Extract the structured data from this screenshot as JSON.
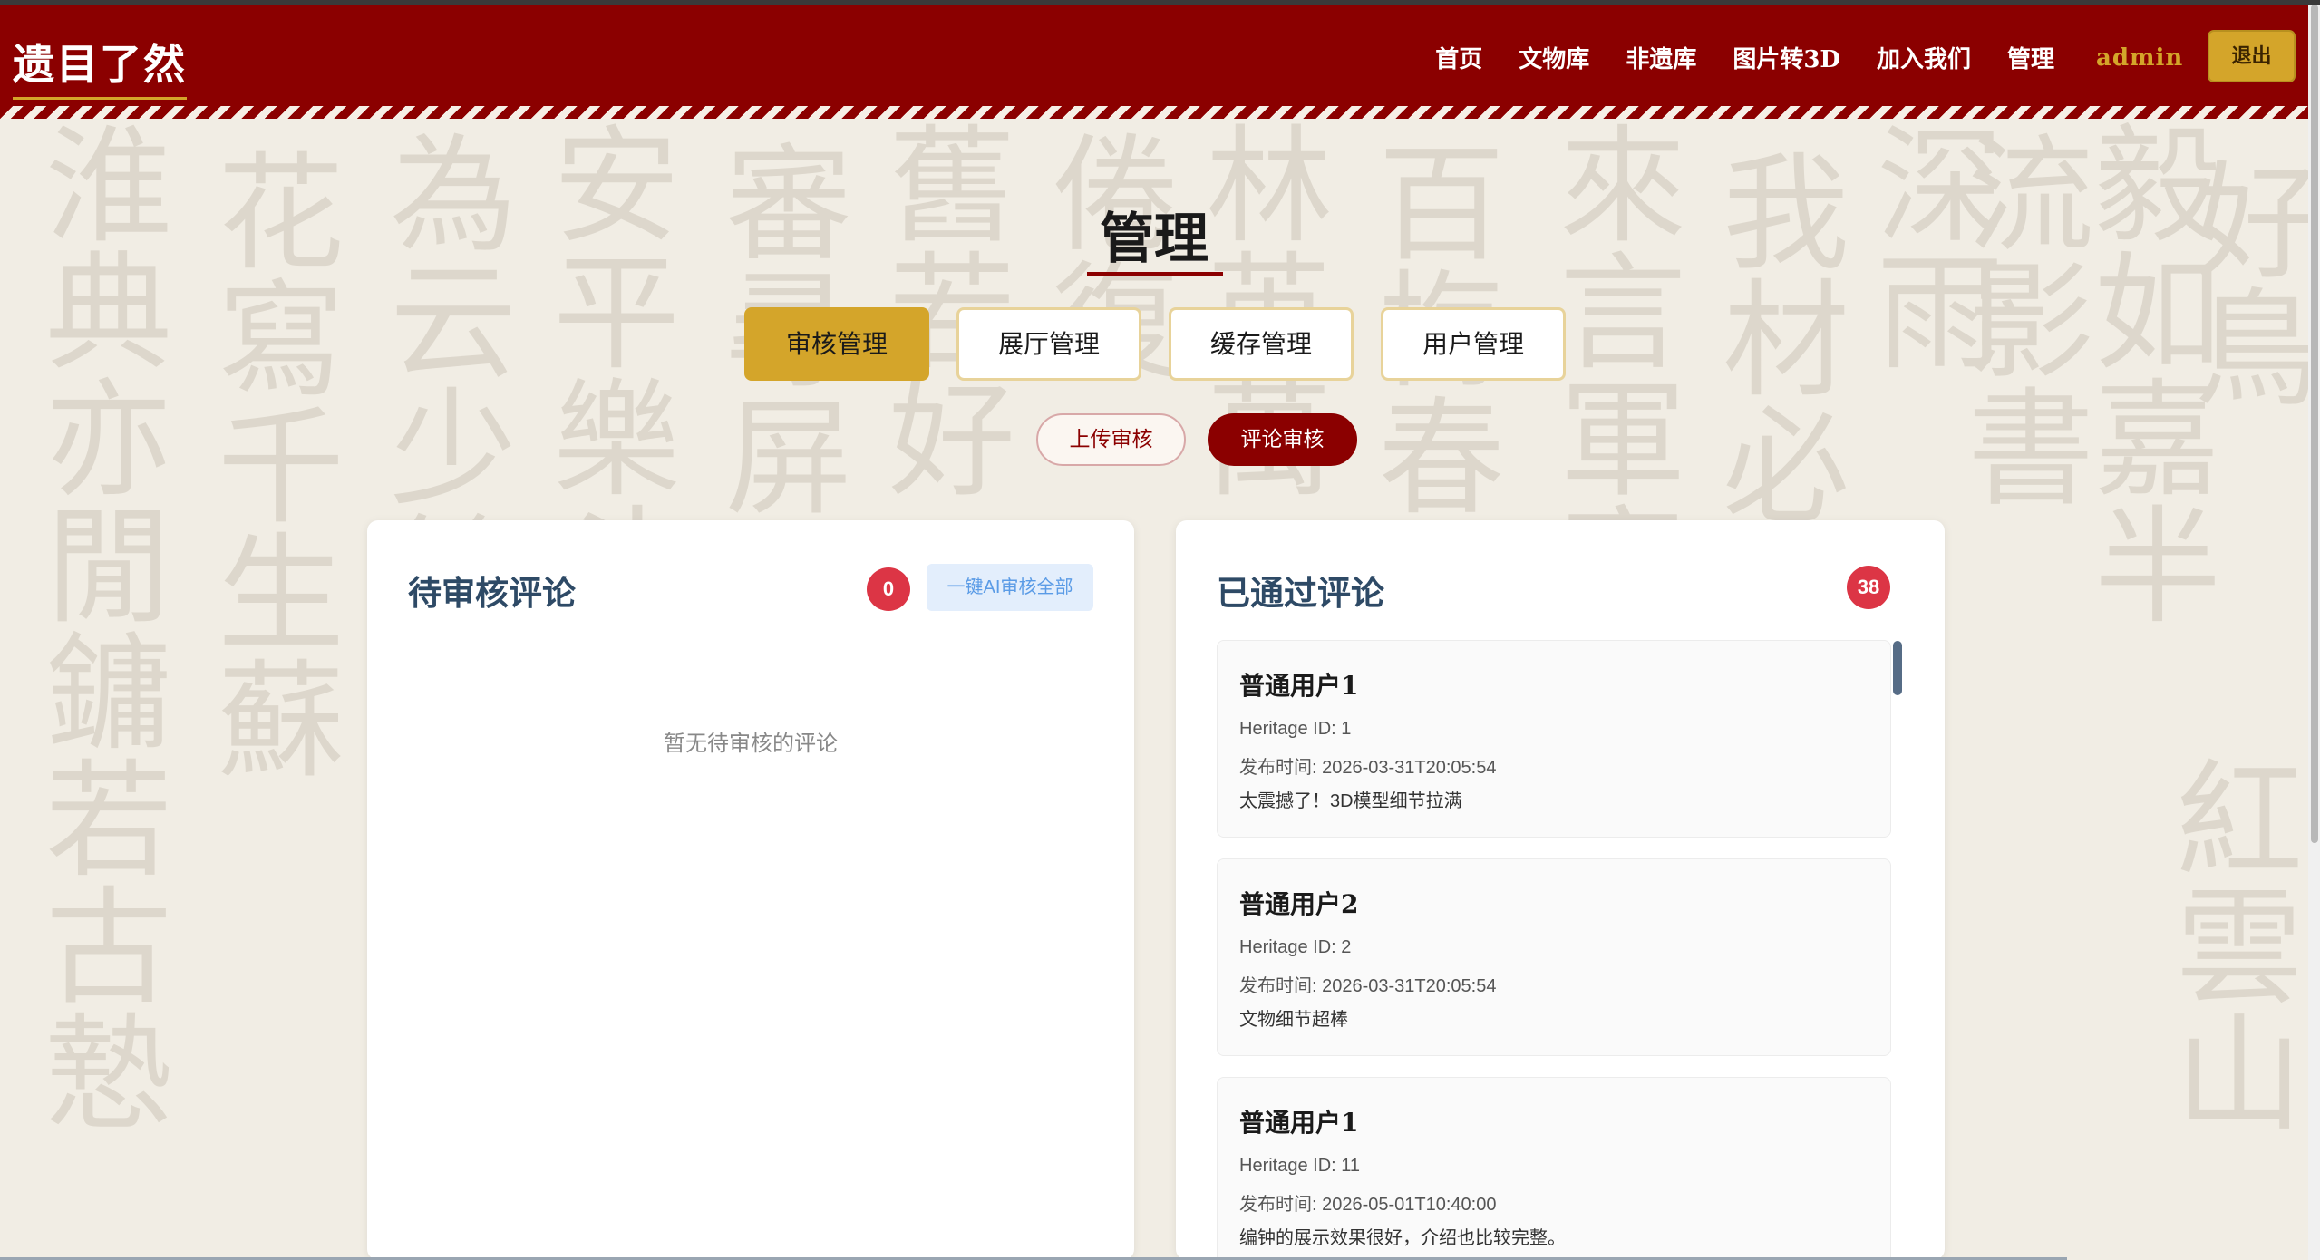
{
  "app": {
    "logo": "遗目了然"
  },
  "nav": {
    "items": [
      "首页",
      "文物库",
      "非遗库",
      "图片转3D",
      "加入我们",
      "管理"
    ],
    "user": "admin",
    "logout": "退出"
  },
  "page": {
    "title": "管理"
  },
  "tabs": [
    "审核管理",
    "展厅管理",
    "缓存管理",
    "用户管理"
  ],
  "subtabs": [
    "上传审核",
    "评论审核"
  ],
  "pending": {
    "title": "待审核评论",
    "count": "0",
    "ai_button": "一键AI审核全部",
    "empty": "暂无待审核的评论"
  },
  "approved": {
    "title": "已通过评论",
    "count": "38",
    "items": [
      {
        "user": "普通用户1",
        "heritage": "Heritage ID: 1",
        "time": "发布时间: 2026-03-31T20:05:54",
        "content": "太震撼了！3D模型细节拉满"
      },
      {
        "user": "普通用户2",
        "heritage": "Heritage ID: 2",
        "time": "发布时间: 2026-03-31T20:05:54",
        "content": "文物细节超棒"
      },
      {
        "user": "普通用户1",
        "heritage": "Heritage ID: 11",
        "time": "发布时间: 2026-05-01T10:40:00",
        "content": "编钟的展示效果很好，介绍也比较完整。"
      }
    ]
  },
  "colors": {
    "brand": "#8b0000",
    "accent": "#d4a52a",
    "badge": "#dc3545",
    "title": "#2e4a66"
  },
  "background_calligraphy": [
    "淮典亦閒鏞若古慹",
    "花寫千生蘇",
    "為云少餘",
    "安平樂斗",
    "審尋屏",
    "舊若好",
    "倦復",
    "林英萬",
    "百梅春",
    "來言軍牽",
    "我材必君",
    "深雨",
    "流影書",
    "毅如嘉半",
    "好鳥",
    "紅雲山"
  ]
}
